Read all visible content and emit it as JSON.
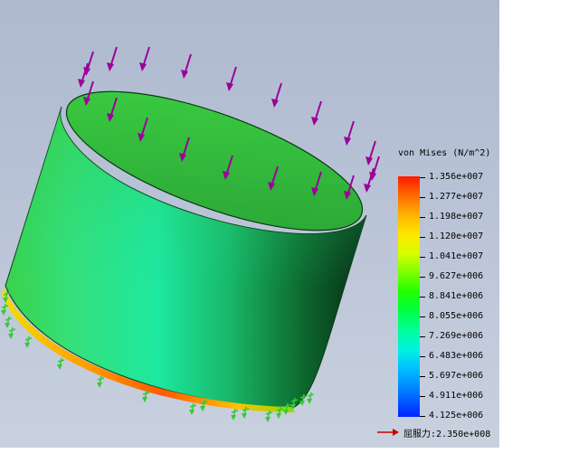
{
  "legend": {
    "title": "von Mises (N/m^2)",
    "ticks": [
      "1.356e+007",
      "1.277e+007",
      "1.198e+007",
      "1.120e+007",
      "1.041e+007",
      "9.627e+006",
      "8.841e+006",
      "8.055e+006",
      "7.269e+006",
      "6.483e+006",
      "5.697e+006",
      "4.911e+006",
      "4.125e+006"
    ],
    "yield_label": "屈服力:",
    "yield_value": "2.350e+008"
  },
  "colors": {
    "max": "#ff1a00",
    "min": "#0022ff",
    "load_arrow": "#9a009a",
    "fixture_arrow": "#33cc33",
    "yield_arrow": "#cc0000"
  },
  "icons": [
    "load-arrow-icon",
    "fixture-arrow-icon",
    "yield-arrow-icon"
  ]
}
